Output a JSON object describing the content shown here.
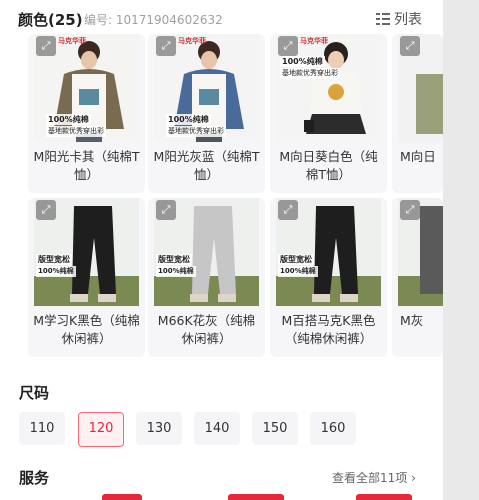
{
  "header": {
    "title": "颜色(25)",
    "code": "编号: 10171904602632",
    "list_toggle": "列表"
  },
  "colors": [
    {
      "label": "M阳光卡其（纯棉T恤）",
      "brand": "马克华菲",
      "tag1": "100%纯棉",
      "tag2": "基地款优秀穿出彩"
    },
    {
      "label": "M阳光灰蓝（纯棉T恤）",
      "brand": "马克华菲",
      "tag1": "100%纯棉",
      "tag2": "基地款优秀穿出彩"
    },
    {
      "label": "M向日葵白色（纯棉T恤）",
      "brand": "马克华菲",
      "tag1": "100%纯棉",
      "tag2": "基地款优秀穿出彩"
    },
    {
      "label": "M向日"
    },
    {
      "label": "M学习K黑色（纯棉休闲裤）",
      "tag1": "版型宽松",
      "tag2": "100%纯棉"
    },
    {
      "label": "M66K花灰（纯棉休闲裤）",
      "tag1": "版型宽松",
      "tag2": "100%纯棉"
    },
    {
      "label": "M百搭马克K黑色（纯棉休闲裤）",
      "tag1": "版型宽松",
      "tag2": "100%纯棉"
    },
    {
      "label": "M灰"
    }
  ],
  "sizes": {
    "title": "尺码",
    "options": [
      "110",
      "120",
      "130",
      "140",
      "150",
      "160"
    ],
    "selected": "120"
  },
  "service": {
    "title": "服务",
    "see_all": "查看全部11项 ›"
  },
  "accent_color": "#e6283a"
}
